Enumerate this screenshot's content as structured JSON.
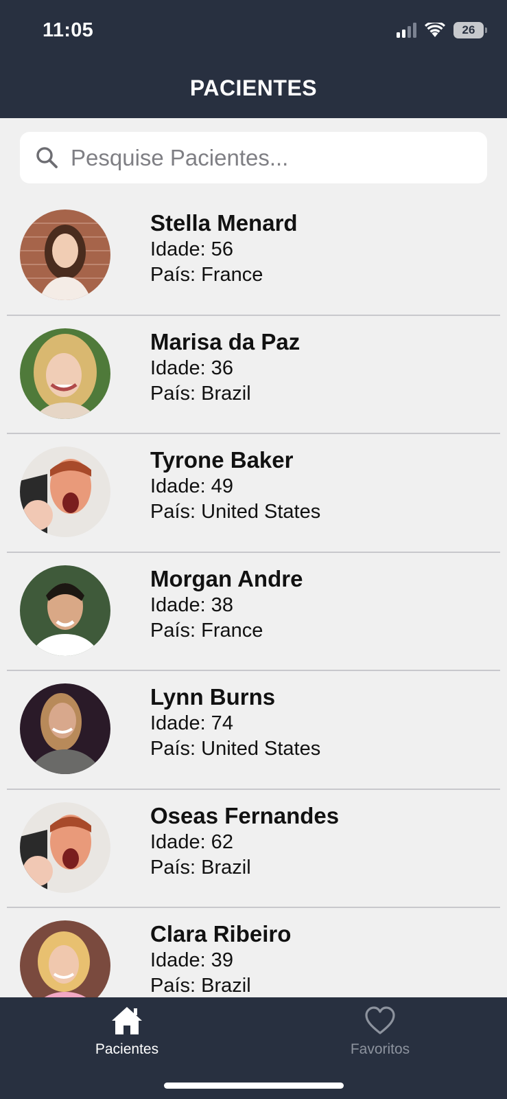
{
  "status_bar": {
    "time": "11:05",
    "battery": "26"
  },
  "header": {
    "title": "PACIENTES"
  },
  "search": {
    "placeholder": "Pesquise Pacientes...",
    "value": ""
  },
  "patients": [
    {
      "name": "Stella Menard",
      "age": "Idade: 56",
      "country": "País: France"
    },
    {
      "name": "Marisa da Paz",
      "age": "Idade: 36",
      "country": "País: Brazil"
    },
    {
      "name": "Tyrone Baker",
      "age": "Idade: 49",
      "country": "País: United States"
    },
    {
      "name": "Morgan Andre",
      "age": "Idade: 38",
      "country": "País: France"
    },
    {
      "name": "Lynn Burns",
      "age": "Idade: 74",
      "country": "País: United States"
    },
    {
      "name": "Oseas Fernandes",
      "age": "Idade: 62",
      "country": "País: Brazil"
    },
    {
      "name": "Clara Ribeiro",
      "age": "Idade: 39",
      "country": "País: Brazil"
    }
  ],
  "tabbar": {
    "items": [
      {
        "label": "Pacientes",
        "icon": "home-icon",
        "active": true
      },
      {
        "label": "Favoritos",
        "icon": "heart-icon",
        "active": false
      }
    ]
  },
  "colors": {
    "header_bg": "#283040",
    "list_bg": "#f0f0f0",
    "active_tab": "#ffffff",
    "inactive_tab": "#8d939e"
  }
}
